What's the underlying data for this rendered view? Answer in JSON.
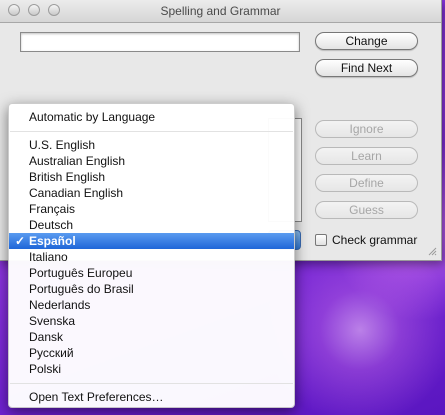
{
  "window": {
    "title": "Spelling and Grammar"
  },
  "word_field": {
    "value": ""
  },
  "buttons": {
    "change": "Change",
    "find_next": "Find Next",
    "ignore": "Ignore",
    "learn": "Learn",
    "define": "Define",
    "guess": "Guess"
  },
  "check_grammar": {
    "label": "Check grammar",
    "checked": false
  },
  "menu": {
    "automatic": "Automatic by Language",
    "languages": [
      "U.S. English",
      "Australian English",
      "British English",
      "Canadian English",
      "Français",
      "Deutsch",
      "Español",
      "Italiano",
      "Português Europeu",
      "Português do Brasil",
      "Nederlands",
      "Svenska",
      "Dansk",
      "Русский",
      "Polski"
    ],
    "selected": "Español",
    "checkmark": "✓",
    "open_prefs": "Open Text Preferences…"
  },
  "colors": {
    "selection": "#1f66d8",
    "desktop": "#7a2ed6"
  }
}
